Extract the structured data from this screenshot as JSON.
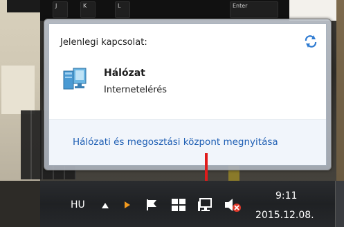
{
  "popup": {
    "header": "Jelenlegi kapcsolat:",
    "network_name": "Hálózat",
    "network_status": "Internetelérés",
    "footer_link": "Hálózati és megosztási központ megnyitása",
    "refresh_icon": "refresh-arrows-icon",
    "network_icon": "network-computer-icon"
  },
  "background": {
    "key_labels": [
      "J",
      "K",
      "L",
      "Enter"
    ]
  },
  "taskbar": {
    "language": "HU",
    "tray_icons": [
      "show-hidden-icons-arrow",
      "orange-arrow-icon",
      "action-center-flag-icon",
      "windows-icon",
      "network-icon",
      "volume-muted-icon"
    ],
    "clock_time": "9:11",
    "clock_date": "2015.12.08."
  },
  "colors": {
    "link": "#1f5fb4",
    "annotation_arrow": "#e01b1b",
    "taskbar": "#1f2124"
  }
}
